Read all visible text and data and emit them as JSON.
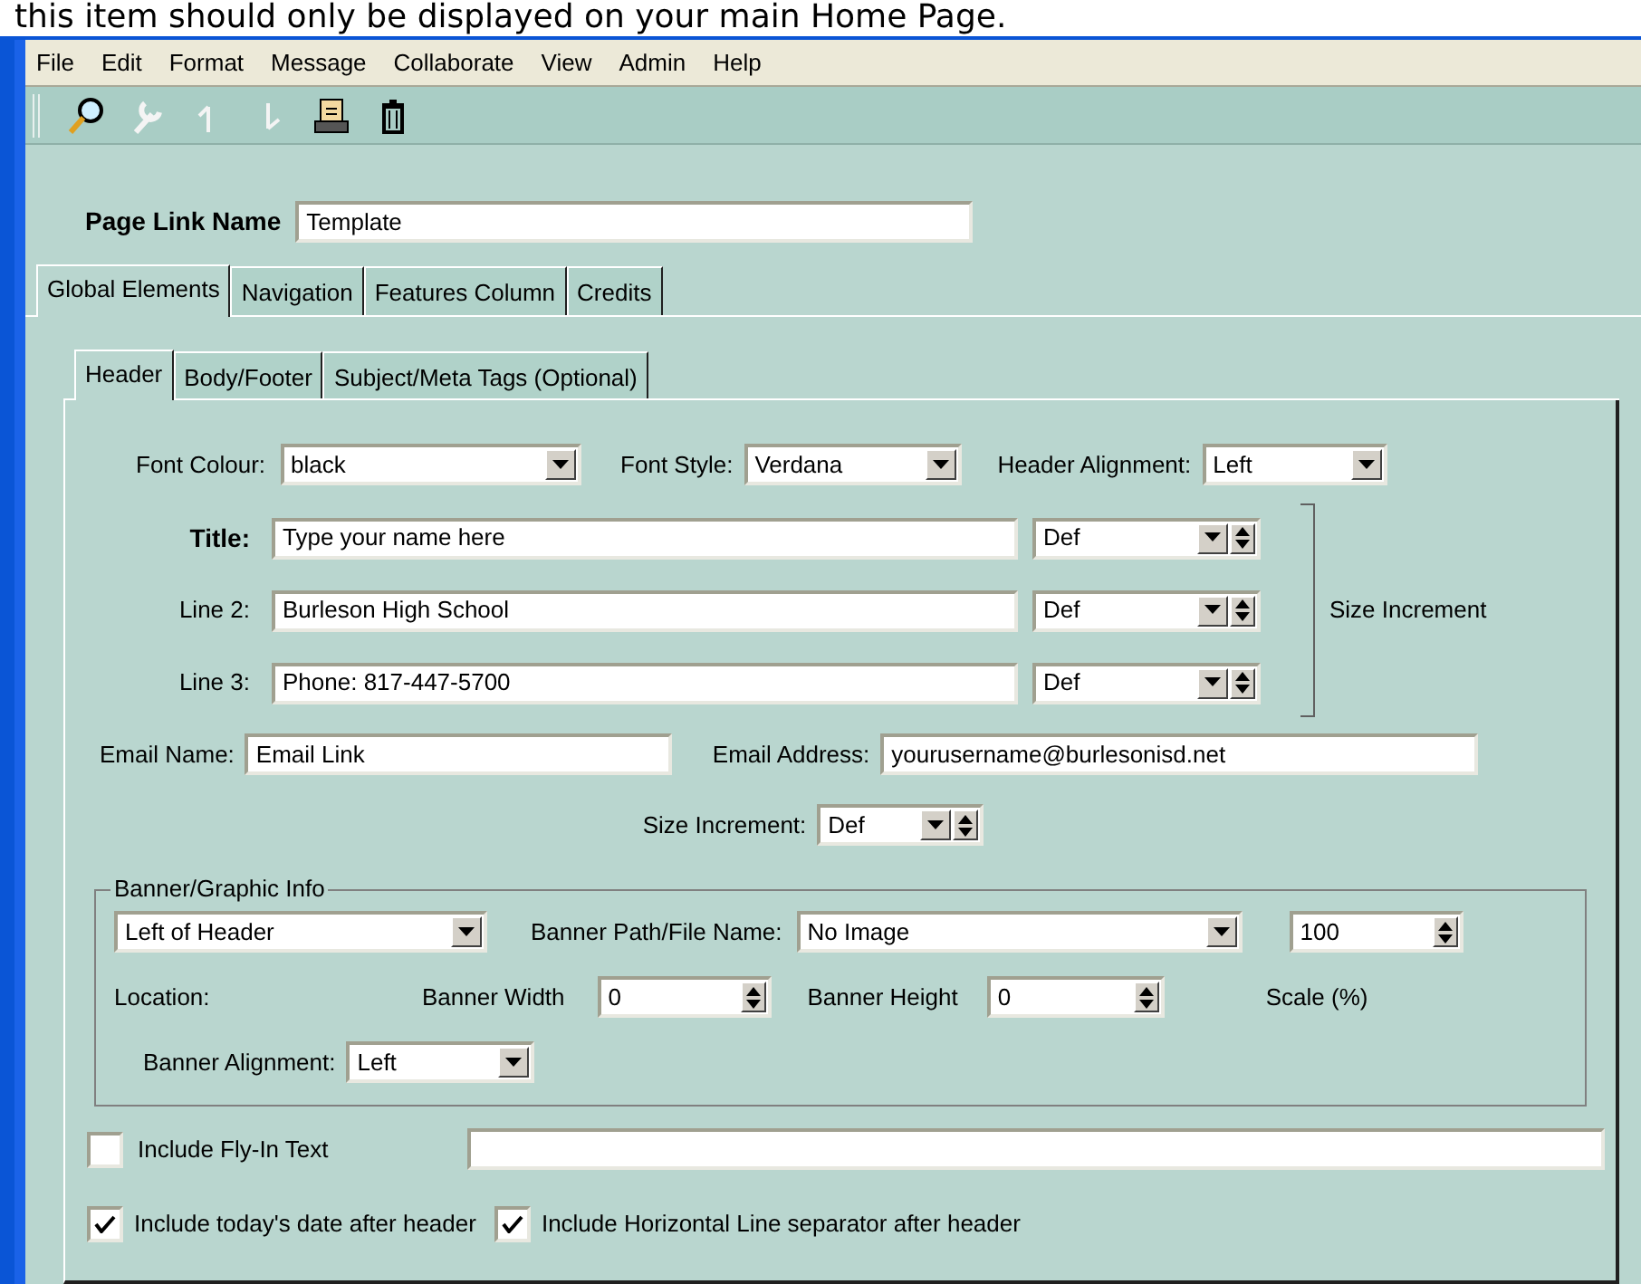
{
  "caption": "this item should only be displayed on your main Home Page.",
  "menu": [
    "File",
    "Edit",
    "Format",
    "Message",
    "Collaborate",
    "View",
    "Admin",
    "Help"
  ],
  "toolbar": [
    {
      "kind": "search",
      "disabled": false
    },
    {
      "kind": "tools",
      "disabled": true
    },
    {
      "kind": "up",
      "disabled": true
    },
    {
      "kind": "down",
      "disabled": true
    },
    {
      "kind": "print",
      "disabled": false
    },
    {
      "kind": "trash",
      "disabled": false
    }
  ],
  "page_link": {
    "label": "Page Link Name",
    "value": "Template"
  },
  "tabs": [
    {
      "label": "Global Elements",
      "selected": true
    },
    {
      "label": "Navigation",
      "selected": false
    },
    {
      "label": "Features Column",
      "selected": false
    },
    {
      "label": "Credits",
      "selected": false
    }
  ],
  "subtabs": [
    {
      "label": "Header",
      "selected": true
    },
    {
      "label": "Body/Footer",
      "selected": false
    },
    {
      "label": "Subject/Meta Tags (Optional)",
      "selected": false
    }
  ],
  "font_colour": {
    "label": "Font Colour:",
    "value": "black"
  },
  "font_style": {
    "label": "Font Style:",
    "value": "Verdana"
  },
  "header_alignment": {
    "label": "Header Alignment:",
    "value": "Left"
  },
  "lines": [
    {
      "label": "Title:",
      "value": "Type your name here",
      "size": "Def",
      "emphasized": true
    },
    {
      "label": "Line 2:",
      "value": "Burleson High School",
      "size": "Def",
      "emphasized": false
    },
    {
      "label": "Line 3:",
      "value": "Phone: 817-447-5700",
      "size": "Def",
      "emphasized": false
    }
  ],
  "lines_size_label": "Size Increment",
  "email_name": {
    "label": "Email Name:",
    "value": "Email Link"
  },
  "email_address": {
    "label": "Email Address:",
    "value": "yourusername@burlesonisd.net"
  },
  "size_increment": {
    "label": "Size Increment:",
    "value": "Def"
  },
  "banner": {
    "legend": "Banner/Graphic Info",
    "location_value": "Left of Header",
    "location_label": "Location:",
    "path_label": "Banner Path/File Name:",
    "path_value": "No Image",
    "scale_value": "100",
    "scale_label": "Scale (%)",
    "width_label": "Banner Width",
    "width_value": "0",
    "height_label": "Banner Height",
    "height_value": "0",
    "alignment_label": "Banner Alignment:",
    "alignment_value": "Left"
  },
  "fly_in": {
    "label": "Include Fly-In Text",
    "checked": false
  },
  "options": [
    {
      "label": "Include today's date after header",
      "checked": true
    },
    {
      "label": "Include Horizontal Line separator after header",
      "checked": true
    }
  ]
}
